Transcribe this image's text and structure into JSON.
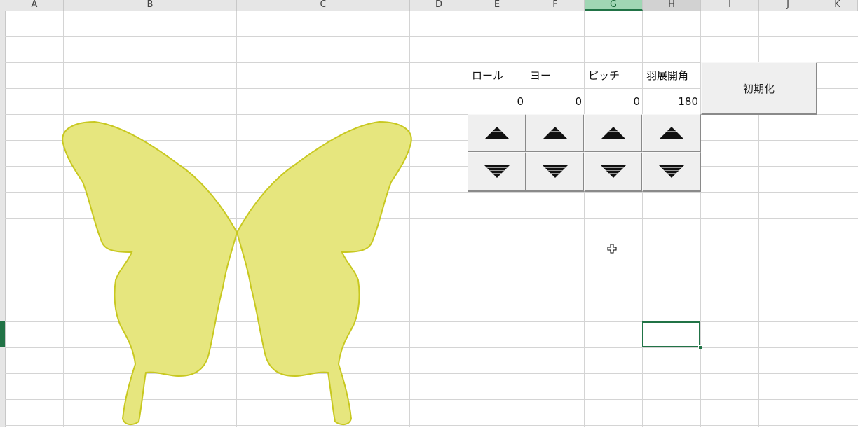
{
  "sheet": {
    "columns": [
      "A",
      "B",
      "C",
      "D",
      "E",
      "F",
      "G",
      "H",
      "I",
      "J",
      "K"
    ],
    "selected_column": "G",
    "highlighted_column": "H"
  },
  "controls": {
    "headers": [
      "ロール",
      "ヨー",
      "ピッチ",
      "羽展開角"
    ],
    "values": [
      "0",
      "0",
      "0",
      "180"
    ],
    "reset_label": "初期化",
    "up_icon": "triangle-up-striped-icon",
    "down_icon": "triangle-down-striped-icon"
  },
  "shape": {
    "name": "butterfly-shape",
    "fill_color": "#e6e67e",
    "stroke_color": "#c8c820"
  },
  "colors": {
    "accent": "#217346",
    "grid": "#d4d4d4",
    "header_bg": "#e6e6e6",
    "button_bg": "#efefef"
  }
}
